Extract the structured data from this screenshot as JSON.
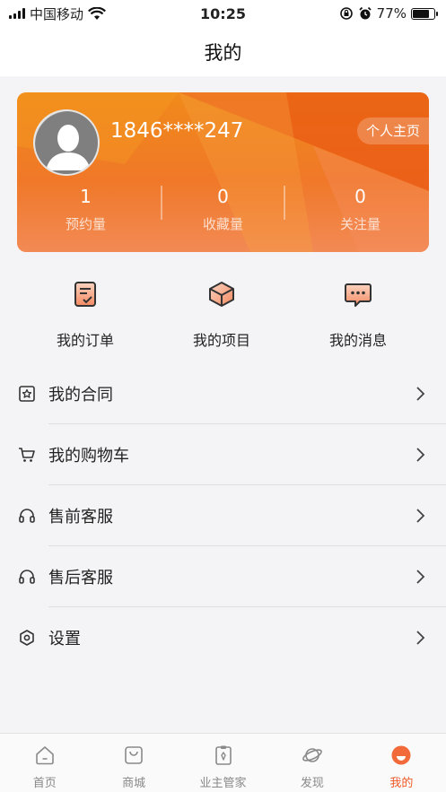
{
  "status_bar": {
    "carrier": "中国移动",
    "time": "10:25",
    "battery": "77%",
    "battery_level": 0.77
  },
  "nav": {
    "title": "我的"
  },
  "profile": {
    "phone": "1846****247",
    "homepage_button": "个人主页",
    "stats": [
      {
        "value": "1",
        "label": "预约量"
      },
      {
        "value": "0",
        "label": "收藏量"
      },
      {
        "value": "0",
        "label": "关注量"
      }
    ]
  },
  "quick_actions": [
    {
      "label": "我的订单",
      "icon": "order-icon"
    },
    {
      "label": "我的项目",
      "icon": "project-icon"
    },
    {
      "label": "我的消息",
      "icon": "message-icon"
    }
  ],
  "menu": [
    {
      "label": "我的合同",
      "icon": "contract-icon"
    },
    {
      "label": "我的购物车",
      "icon": "cart-icon"
    },
    {
      "label": "售前客服",
      "icon": "headset-icon"
    },
    {
      "label": "售后客服",
      "icon": "headset-icon"
    },
    {
      "label": "设置",
      "icon": "settings-icon"
    }
  ],
  "tabs": [
    {
      "label": "首页",
      "icon": "home-icon"
    },
    {
      "label": "商城",
      "icon": "shop-icon"
    },
    {
      "label": "业主管家",
      "icon": "butler-icon"
    },
    {
      "label": "发现",
      "icon": "planet-icon"
    },
    {
      "label": "我的",
      "icon": "smile-icon",
      "active": true
    }
  ],
  "colors": {
    "accent": "#f05a28",
    "card_orange": "#f07828"
  }
}
